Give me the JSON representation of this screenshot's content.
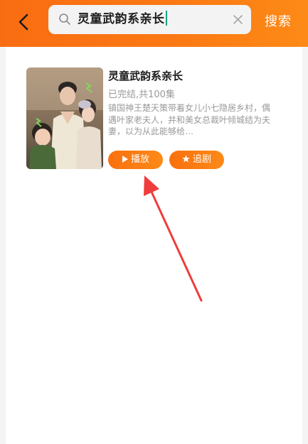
{
  "header": {
    "search_value": "灵童武韵系亲长",
    "search_button_label": "搜索"
  },
  "result": {
    "title": "灵童武韵系亲长",
    "status": "已完结,共100集",
    "description": "镇国神王楚天策带着女儿小七隐居乡村，偶遇叶家老夫人，并和美女总裁叶倾城结为夫妻，以为从此能够给…",
    "play_label": "播放",
    "follow_label": "追剧"
  },
  "colors": {
    "header_orange": "#fb7a14",
    "annotation_arrow": "#ef3d3d"
  },
  "icons": [
    "back-arrow-icon",
    "search-icon",
    "clear-icon",
    "play-icon",
    "star-icon"
  ]
}
